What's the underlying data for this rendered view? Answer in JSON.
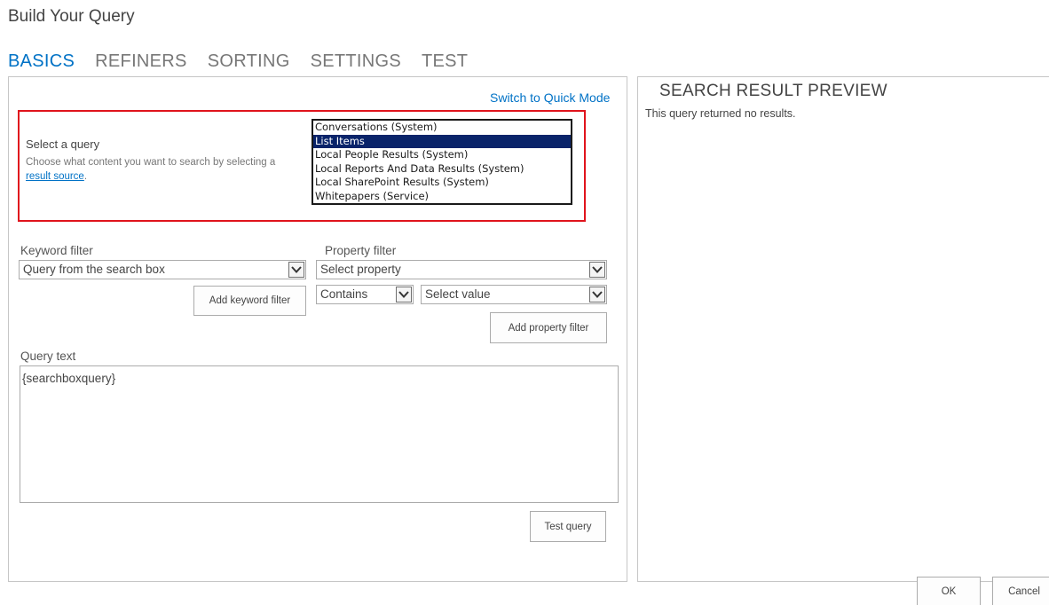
{
  "page": {
    "title": "Build Your Query"
  },
  "tabs": [
    {
      "label": "BASICS",
      "active": true
    },
    {
      "label": "REFINERS",
      "active": false
    },
    {
      "label": "SORTING",
      "active": false
    },
    {
      "label": "SETTINGS",
      "active": false
    },
    {
      "label": "TEST",
      "active": false
    }
  ],
  "basics": {
    "switch_mode_link": "Switch to Quick Mode",
    "select_query": {
      "label": "Select a query",
      "description_prefix": "Choose what content you want to search by selecting a ",
      "description_link": "result source",
      "description_suffix": ".",
      "options": [
        "Conversations (System)",
        "List Items",
        "Local People Results (System)",
        "Local Reports And Data Results (System)",
        "Local SharePoint Results (System)",
        "Whitepapers (Service)"
      ],
      "selected": "List Items"
    },
    "keyword_filter": {
      "label": "Keyword filter",
      "value": "Query from the search box",
      "add_button": "Add keyword filter"
    },
    "property_filter": {
      "label": "Property filter",
      "property_value": "Select property",
      "operator_value": "Contains",
      "value_value": "Select value",
      "add_button": "Add property filter"
    },
    "query_text": {
      "label": "Query text",
      "value": "{searchboxquery}"
    },
    "test_button": "Test query"
  },
  "preview": {
    "title": "SEARCH RESULT PREVIEW",
    "message": "This query returned no results."
  },
  "footer": {
    "ok_label": "OK",
    "cancel_label": "Cancel"
  },
  "colors": {
    "accent": "#0072c6",
    "highlight_border": "#e0141d",
    "selected_option": "#0a246a"
  }
}
